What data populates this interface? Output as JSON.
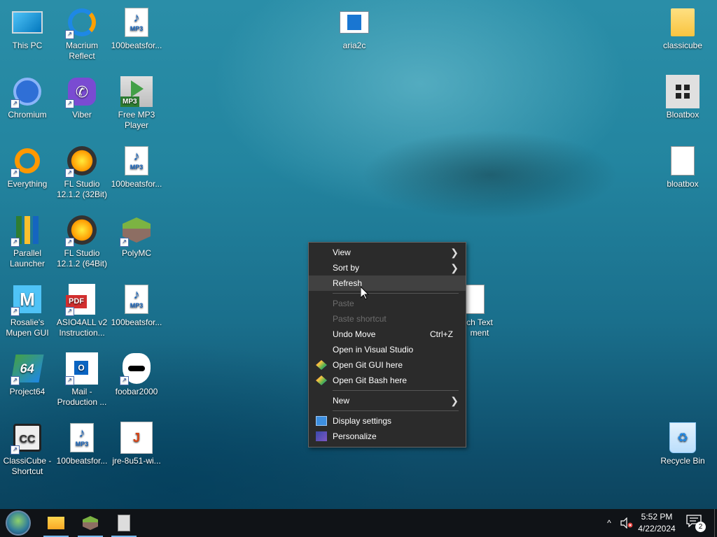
{
  "desktop": {
    "icons": {
      "this_pc": "This PC",
      "macrium": "Macrium Reflect",
      "beats1": "100beatsfor...",
      "aria2c": "aria2c",
      "classicube": "classicube",
      "chromium": "Chromium",
      "viber": "Viber",
      "free_mp3": "Free MP3 Player",
      "bloatbox_app": "Bloatbox",
      "everything": "Everything",
      "fl32": "FL Studio 12.1.2 (32Bit)",
      "beats2": "100beatsfor...",
      "bloatbox_txt": "bloatbox",
      "parallel": "Parallel Launcher",
      "fl64": "FL Studio 12.1.2 (64Bit)",
      "polymc": "PolyMC",
      "rosalie": "Rosalie's Mupen GUI",
      "asio": "ASIO4ALL v2 Instruction...",
      "beats3": "100beatsfor...",
      "partial_doc": "ch Text ment",
      "project64": "Project64",
      "mail": "Mail - Production ...",
      "foobar": "foobar2000",
      "classicube_shortcut": "ClassiCube - Shortcut",
      "beats4": "100beatsfor...",
      "jre": "jre-8u51-wi...",
      "recycle": "Recycle Bin"
    },
    "icon_glyphs": {
      "mp3_tag": "MP3",
      "pdf_tag": "PDF",
      "freemp3_tag": "MP3",
      "rosalie_mark": "M",
      "mail_mark": "O",
      "p64_mark": "64",
      "classic_mark": "CC",
      "java_mark": "J",
      "recycle_mark": "♻",
      "viber_mark": "✆"
    }
  },
  "context_menu": {
    "view": "View",
    "sort_by": "Sort by",
    "refresh": "Refresh",
    "paste": "Paste",
    "paste_shortcut": "Paste shortcut",
    "undo_move": "Undo Move",
    "undo_accel": "Ctrl+Z",
    "open_vs": "Open in Visual Studio",
    "git_gui": "Open Git GUI here",
    "git_bash": "Open Git Bash here",
    "new": "New",
    "display_settings": "Display settings",
    "personalize": "Personalize",
    "submenu_arrow": "❯"
  },
  "taskbar": {
    "time": "5:52 PM",
    "date": "4/22/2024",
    "notification_count": "2",
    "tray_chevron": "^",
    "icons": [
      "start-orb-icon",
      "file-explorer-icon",
      "polymc-icon",
      "notepad-icon",
      "volume-muted-icon",
      "action-center-icon"
    ]
  },
  "colors": {
    "menu_bg": "#2b2b2b",
    "menu_hover": "#414141",
    "taskbar_bg": "#101317",
    "accent": "#76b9ed"
  }
}
